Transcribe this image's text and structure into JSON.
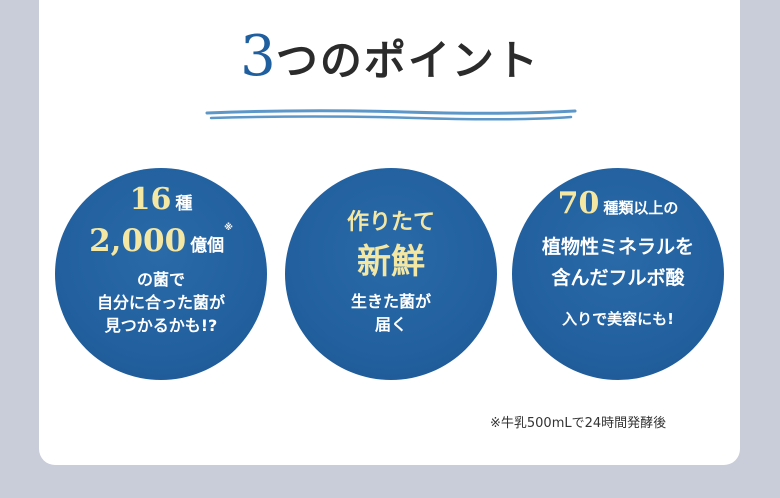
{
  "title": {
    "number": "3",
    "text": "つのポイント"
  },
  "colors": {
    "circle": "#2260a0",
    "accent_yellow": "#f3e7a3",
    "number_blue": "#1f5f9f",
    "background": "#c9ccd9"
  },
  "points": [
    {
      "line1_num": "16",
      "line1_unit": "種",
      "line2_num": "2,000",
      "line2_unit": "億個",
      "line2_mark": "※",
      "line3": "の菌で",
      "line4": "自分に合った菌が",
      "line5": "見つかるかも!?"
    },
    {
      "line1": "作りたて",
      "line2": "新鮮",
      "line3": "生きた菌が",
      "line4": "届く"
    },
    {
      "line1_num": "70",
      "line1_unit": "種類以上の",
      "line2": "植物性ミネラルを",
      "line3": "含んだフルボ酸",
      "line4": "入りで美容にも!"
    }
  ],
  "footnote": "※牛乳500mLで24時間発酵後"
}
